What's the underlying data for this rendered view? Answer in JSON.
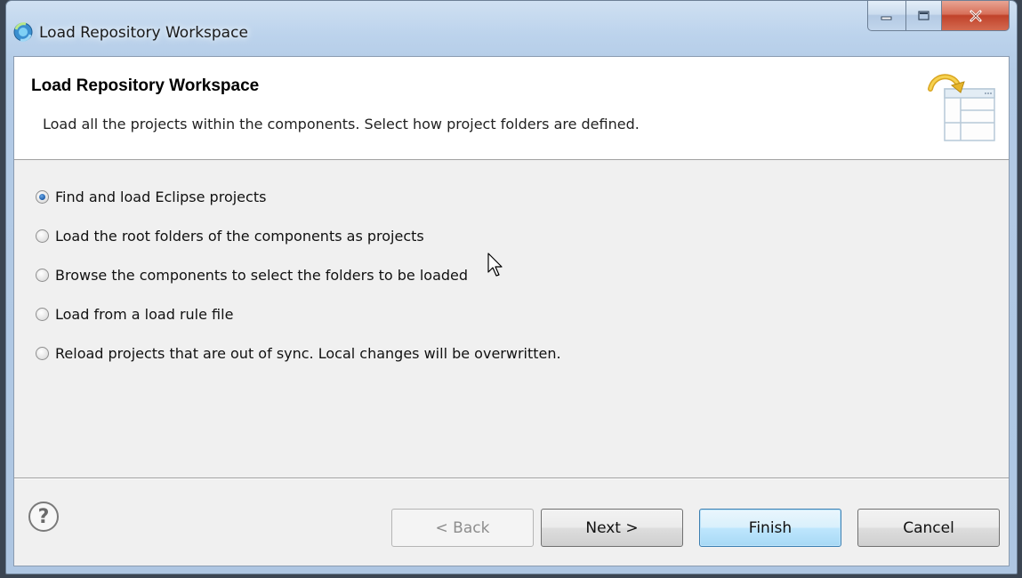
{
  "window": {
    "title": "Load Repository Workspace",
    "controls": {
      "minimize": "minimize-icon",
      "maximize": "maximize-icon",
      "close": "close-icon"
    }
  },
  "banner": {
    "title": "Load Repository Workspace",
    "description": "Load all the projects within the components. Select how project folders are defined."
  },
  "options": [
    {
      "label": "Find and load Eclipse projects",
      "selected": true
    },
    {
      "label": "Load the root folders of the components as projects",
      "selected": false
    },
    {
      "label": "Browse the components to select the folders to be loaded",
      "selected": false
    },
    {
      "label": "Load from a load rule file",
      "selected": false
    },
    {
      "label": "Reload projects that are out of sync. Local changes will be overwritten.",
      "selected": false
    }
  ],
  "footer": {
    "help": "?",
    "back": "< Back",
    "next": "Next >",
    "finish": "Finish",
    "cancel": "Cancel"
  },
  "colors": {
    "title_bar": "#b3cbe6",
    "dialog_bg": "#f0f0f0",
    "banner_bg": "#ffffff",
    "default_button": "#bee6fd",
    "close_button": "#c0422a"
  }
}
